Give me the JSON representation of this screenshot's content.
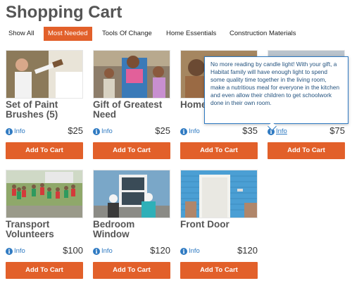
{
  "page": {
    "title": "Shopping Cart"
  },
  "filters": [
    {
      "label": "Show All",
      "active": false
    },
    {
      "label": "Most Needed",
      "active": true
    },
    {
      "label": "Tools Of Change",
      "active": false
    },
    {
      "label": "Home Essentials",
      "active": false
    },
    {
      "label": "Construction Materials",
      "active": false
    }
  ],
  "common": {
    "info_label": "Info",
    "add_label": "Add To Cart"
  },
  "products": [
    {
      "title": "Set of Paint Brushes (5)",
      "price": "$25",
      "image": "paint-brushes"
    },
    {
      "title": "Gift of Greatest Need",
      "price": "$25",
      "image": "family-children"
    },
    {
      "title": "Home Outlet",
      "price": "$35",
      "image": "home-outlet"
    },
    {
      "title": "",
      "price": "$75",
      "image": "light-fixture"
    },
    {
      "title": "Transport Volunteers",
      "price": "$100",
      "image": "volunteers-group"
    },
    {
      "title": "Bedroom Window",
      "price": "$120",
      "image": "window-install"
    },
    {
      "title": "Front Door",
      "price": "$120",
      "image": "front-door"
    }
  ],
  "tooltip": {
    "text": "No more reading by candle light! With your gift, a Habitat family will have enough light to spend some quality time together in the living room, make a nutritious meal for everyone in the kitchen and even allow their children to get schoolwork done in their own room."
  },
  "colors": {
    "accent": "#e2602a",
    "link": "#2f7ac2",
    "title": "#555555"
  }
}
